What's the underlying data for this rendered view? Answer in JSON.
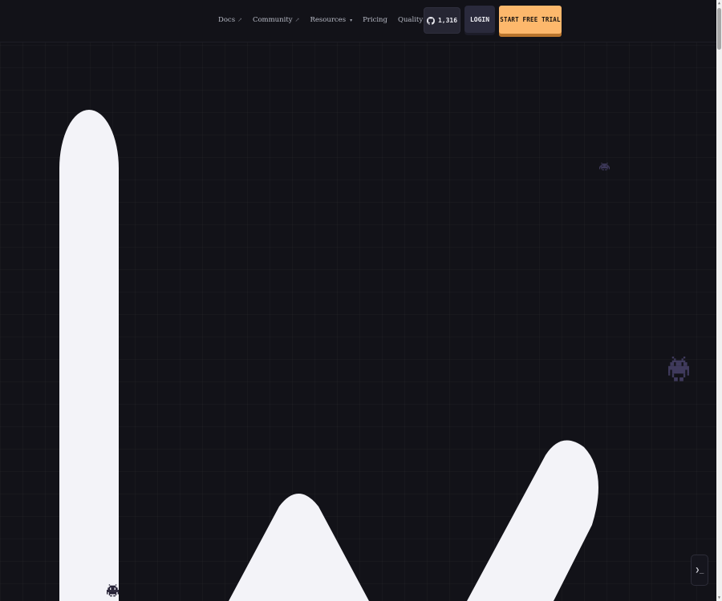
{
  "nav": {
    "items": [
      {
        "label": "Docs",
        "suffix": "↗"
      },
      {
        "label": "Community",
        "suffix": "↗"
      },
      {
        "label": "Resources",
        "suffix": "▾"
      },
      {
        "label": "Pricing",
        "suffix": ""
      },
      {
        "label": "Quality Sprint",
        "suffix": ""
      }
    ]
  },
  "header": {
    "github_stars": "1,316",
    "login_label": "LOGIN",
    "trial_label": "START FREE TRIAL"
  },
  "terminal": {
    "glyph": "❯_"
  },
  "icons": {
    "github": "github-icon",
    "invader": "space-invader-icon",
    "terminal": "terminal-icon"
  },
  "colors": {
    "background": "#121218",
    "accent": "#fdb86c",
    "accent_shadow": "#b9752d",
    "button_dark": "#2a2a3c",
    "hero_shape": "#f3f3f8",
    "invader_muted": "#3f3a5c",
    "invader_dark": "#221e32"
  }
}
